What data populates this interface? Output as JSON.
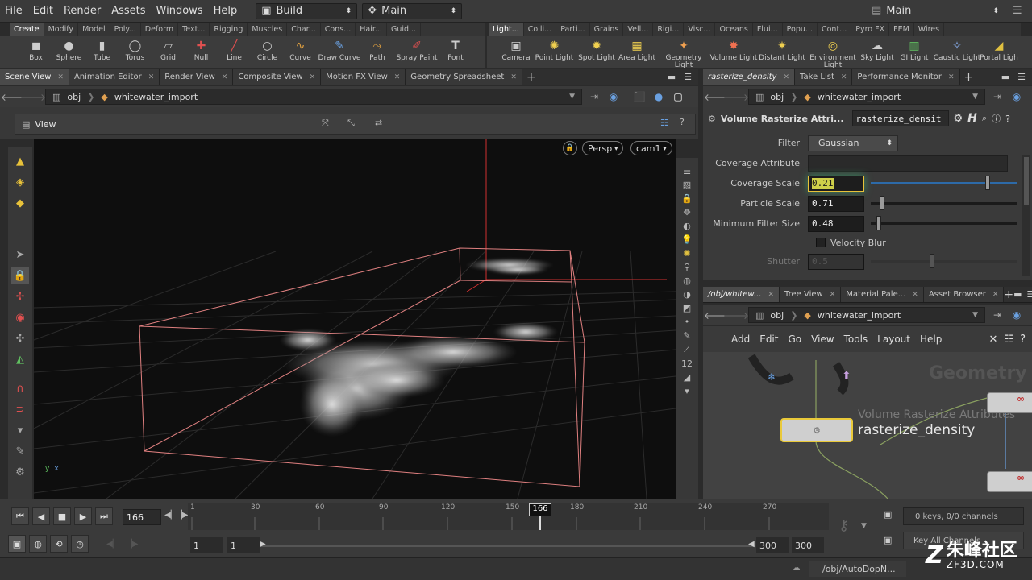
{
  "menu": {
    "file": "File",
    "edit": "Edit",
    "render": "Render",
    "assets": "Assets",
    "windows": "Windows",
    "help": "Help"
  },
  "desktop": {
    "build": "Build",
    "main": "Main",
    "main_right": "Main"
  },
  "shelf_tabs_left": [
    "Create",
    "Modify",
    "Model",
    "Poly...",
    "Deform",
    "Text...",
    "Rigging",
    "Muscles",
    "Char...",
    "Cons...",
    "Hair...",
    "Guid..."
  ],
  "shelf_tabs_right": [
    "Light...",
    "Colli...",
    "Parti...",
    "Grains",
    "Vell...",
    "Rigi...",
    "Visc...",
    "Oceans",
    "Flui...",
    "Popu...",
    "Cont...",
    "Pyro FX",
    "FEM",
    "Wires"
  ],
  "tools_left": [
    {
      "label": "Box",
      "icon": "◼"
    },
    {
      "label": "Sphere",
      "icon": "●"
    },
    {
      "label": "Tube",
      "icon": "▮"
    },
    {
      "label": "Torus",
      "icon": "◯"
    },
    {
      "label": "Grid",
      "icon": "▱"
    },
    {
      "label": "Null",
      "icon": "✚"
    },
    {
      "label": "Line",
      "icon": "╱"
    },
    {
      "label": "Circle",
      "icon": "○"
    },
    {
      "label": "Curve",
      "icon": "∿"
    },
    {
      "label": "Draw Curve",
      "icon": "✎"
    },
    {
      "label": "Path",
      "icon": "⤳"
    },
    {
      "label": "Spray Paint",
      "icon": "✐"
    },
    {
      "label": "Font",
      "icon": "T"
    }
  ],
  "tools_right": [
    {
      "label": "Camera",
      "icon": "▣"
    },
    {
      "label": "Point Light",
      "icon": "✺"
    },
    {
      "label": "Spot Light",
      "icon": "✹"
    },
    {
      "label": "Area Light",
      "icon": "▦"
    },
    {
      "label": "Geometry Light",
      "icon": "✦"
    },
    {
      "label": "Volume Light",
      "icon": "✸"
    },
    {
      "label": "Distant Light",
      "icon": "✷"
    },
    {
      "label": "Environment Light",
      "icon": "◎"
    },
    {
      "label": "Sky Light",
      "icon": "☁"
    },
    {
      "label": "GI Light",
      "icon": "▥"
    },
    {
      "label": "Caustic Light",
      "icon": "✧"
    },
    {
      "label": "Portal Ligh",
      "icon": "◢"
    }
  ],
  "left_tabs": [
    "Scene View",
    "Animation Editor",
    "Render View",
    "Composite View",
    "Motion FX View",
    "Geometry Spreadsheet"
  ],
  "right_top_tabs": [
    "rasterize_density",
    "Take List",
    "Performance Monitor"
  ],
  "right_bot_tabs": [
    "/obj/whitew...",
    "Tree View",
    "Material Pale...",
    "Asset Browser"
  ],
  "path": {
    "obj": "obj",
    "node": "whitewater_import"
  },
  "viewport": {
    "title": "View",
    "persp": "Persp",
    "cam": "cam1"
  },
  "params": {
    "node_type": "Volume Rasterize Attri...",
    "node_name": "rasterize_densit",
    "filter_label": "Filter",
    "filter_value": "Gaussian",
    "coverage_attr_label": "Coverage Attribute",
    "coverage_scale_label": "Coverage Scale",
    "coverage_scale_value": "0.21",
    "particle_scale_label": "Particle Scale",
    "particle_scale_value": "0.71",
    "min_filter_label": "Minimum Filter Size",
    "min_filter_value": "0.48",
    "velocity_blur_label": "Velocity Blur",
    "shutter_label": "Shutter",
    "shutter_value": "0.5",
    "coverage_scale_frac": 0.78,
    "particle_scale_frac": 0.06,
    "min_filter_frac": 0.04
  },
  "network_menu": [
    "Add",
    "Edit",
    "Go",
    "View",
    "Tools",
    "Layout",
    "Help"
  ],
  "network": {
    "watermark": "Geometry",
    "node_type": "Volume Rasterize Attributes",
    "node_name": "rasterize_density"
  },
  "timeline": {
    "frame": "166",
    "ticks": [
      "1",
      "30",
      "60",
      "90",
      "120",
      "150",
      "180",
      "210",
      "240",
      "270"
    ],
    "current": "166",
    "start1": "1",
    "start2": "1",
    "end1": "300",
    "end2": "300",
    "keys": "0 keys, 0/0 channels",
    "key_all": "Key All Channels"
  },
  "status": {
    "path": "/obj/AutoDopN..."
  },
  "watermark": {
    "brand": "朱峰社区",
    "url": "ZF3D.COM"
  }
}
